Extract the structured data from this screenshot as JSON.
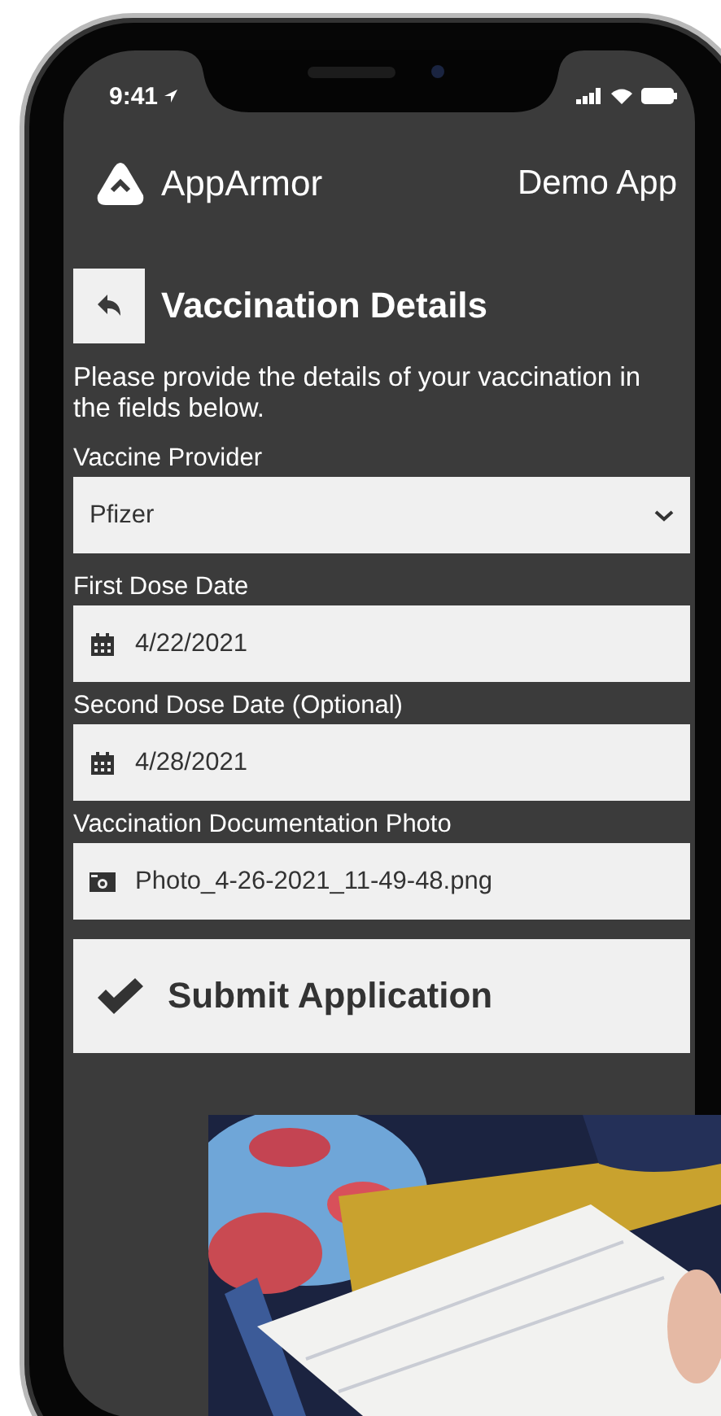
{
  "status_bar": {
    "time": "9:41"
  },
  "header": {
    "brand": "AppArmor",
    "app_name": "Demo App"
  },
  "page": {
    "title": "Vaccination Details",
    "description": "Please provide the details of your vaccination in the fields below."
  },
  "fields": [
    {
      "kind": "select",
      "label": "Vaccine Provider",
      "value": "Pfizer"
    },
    {
      "kind": "date",
      "label": "First Dose Date",
      "value": "4/22/2021"
    },
    {
      "kind": "date",
      "label": "Second Dose Date (Optional)",
      "value": "4/28/2021"
    },
    {
      "label": "Vaccination Documentation Photo",
      "value": "Photo_4-26-2021_11-49-48.png"
    }
  ],
  "submit_button": {
    "label": "Submit Application"
  }
}
